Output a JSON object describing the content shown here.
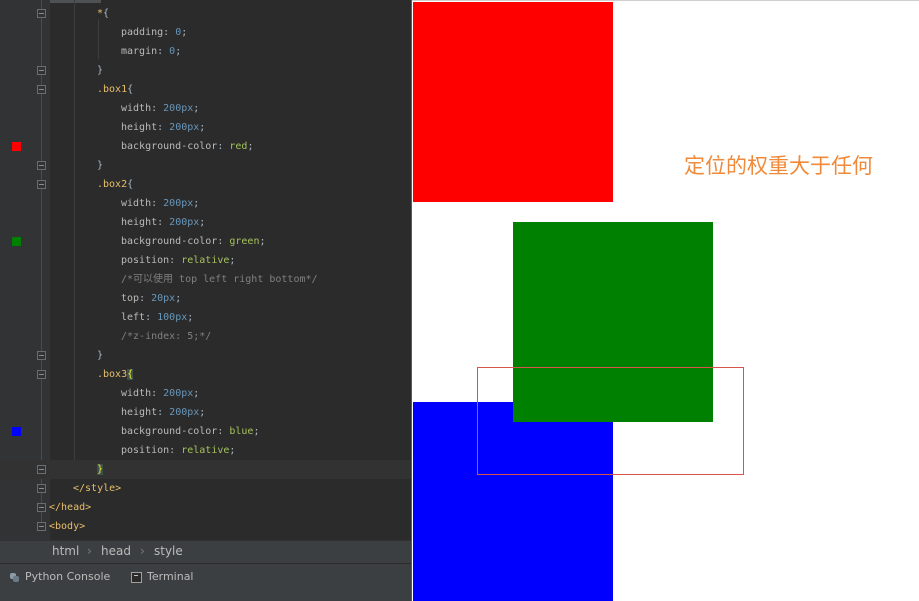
{
  "editor": {
    "lines": [
      {
        "segments": [
          {
            "cls": "tok-sel",
            "text": "*"
          },
          {
            "cls": "tok-brace",
            "text": "{"
          }
        ]
      },
      {
        "segments": [
          {
            "cls": "tok-prop",
            "text": "padding"
          },
          {
            "cls": "tok-brace",
            "text": ": "
          },
          {
            "cls": "tok-num",
            "text": "0"
          },
          {
            "cls": "tok-brace",
            "text": ";"
          }
        ]
      },
      {
        "segments": [
          {
            "cls": "tok-prop",
            "text": "margin"
          },
          {
            "cls": "tok-brace",
            "text": ": "
          },
          {
            "cls": "tok-num",
            "text": "0"
          },
          {
            "cls": "tok-brace",
            "text": ";"
          }
        ]
      },
      {
        "segments": [
          {
            "cls": "tok-brace",
            "text": "}"
          }
        ]
      },
      {
        "segments": [
          {
            "cls": "tok-cls",
            "text": ".box1"
          },
          {
            "cls": "tok-brace",
            "text": "{"
          }
        ]
      },
      {
        "segments": [
          {
            "cls": "tok-prop",
            "text": "width"
          },
          {
            "cls": "tok-brace",
            "text": ": "
          },
          {
            "cls": "tok-num",
            "text": "200px"
          },
          {
            "cls": "tok-brace",
            "text": ";"
          }
        ]
      },
      {
        "segments": [
          {
            "cls": "tok-prop",
            "text": "height"
          },
          {
            "cls": "tok-brace",
            "text": ": "
          },
          {
            "cls": "tok-num",
            "text": "200px"
          },
          {
            "cls": "tok-brace",
            "text": ";"
          }
        ]
      },
      {
        "segments": [
          {
            "cls": "tok-prop",
            "text": "background-color"
          },
          {
            "cls": "tok-brace",
            "text": ": "
          },
          {
            "cls": "tok-kw",
            "text": "red"
          },
          {
            "cls": "tok-brace",
            "text": ";"
          }
        ],
        "swatch": "#ff0000"
      },
      {
        "segments": [
          {
            "cls": "tok-brace",
            "text": "}"
          }
        ]
      },
      {
        "segments": [
          {
            "cls": "tok-cls",
            "text": ".box2"
          },
          {
            "cls": "tok-brace",
            "text": "{"
          }
        ]
      },
      {
        "segments": [
          {
            "cls": "tok-prop",
            "text": "width"
          },
          {
            "cls": "tok-brace",
            "text": ": "
          },
          {
            "cls": "tok-num",
            "text": "200px"
          },
          {
            "cls": "tok-brace",
            "text": ";"
          }
        ]
      },
      {
        "segments": [
          {
            "cls": "tok-prop",
            "text": "height"
          },
          {
            "cls": "tok-brace",
            "text": ": "
          },
          {
            "cls": "tok-num",
            "text": "200px"
          },
          {
            "cls": "tok-brace",
            "text": ";"
          }
        ]
      },
      {
        "segments": [
          {
            "cls": "tok-prop",
            "text": "background-color"
          },
          {
            "cls": "tok-brace",
            "text": ": "
          },
          {
            "cls": "tok-kw",
            "text": "green"
          },
          {
            "cls": "tok-brace",
            "text": ";"
          }
        ],
        "swatch": "#008000"
      },
      {
        "segments": [
          {
            "cls": "tok-prop",
            "text": "position"
          },
          {
            "cls": "tok-brace",
            "text": ": "
          },
          {
            "cls": "tok-kw",
            "text": "relative"
          },
          {
            "cls": "tok-brace",
            "text": ";"
          }
        ]
      },
      {
        "segments": [
          {
            "cls": "tok-cmt",
            "text": "/*可以使用 top left right bottom*/"
          }
        ]
      },
      {
        "segments": [
          {
            "cls": "tok-prop",
            "text": "top"
          },
          {
            "cls": "tok-brace",
            "text": ": "
          },
          {
            "cls": "tok-num",
            "text": "20px"
          },
          {
            "cls": "tok-brace",
            "text": ";"
          }
        ]
      },
      {
        "segments": [
          {
            "cls": "tok-prop",
            "text": "left"
          },
          {
            "cls": "tok-brace",
            "text": ": "
          },
          {
            "cls": "tok-num",
            "text": "100px"
          },
          {
            "cls": "tok-brace",
            "text": ";"
          }
        ]
      },
      {
        "segments": [
          {
            "cls": "tok-cmt",
            "text": "/*z-index: 5;*/"
          }
        ]
      },
      {
        "segments": [
          {
            "cls": "tok-brace",
            "text": "}"
          }
        ]
      },
      {
        "segments": [
          {
            "cls": "tok-cls",
            "text": ".box3"
          },
          {
            "cls": "tok-brace-hl",
            "text": "{"
          }
        ]
      },
      {
        "segments": [
          {
            "cls": "tok-prop",
            "text": "width"
          },
          {
            "cls": "tok-brace",
            "text": ": "
          },
          {
            "cls": "tok-num",
            "text": "200px"
          },
          {
            "cls": "tok-brace",
            "text": ";"
          }
        ]
      },
      {
        "segments": [
          {
            "cls": "tok-prop",
            "text": "height"
          },
          {
            "cls": "tok-brace",
            "text": ": "
          },
          {
            "cls": "tok-num",
            "text": "200px"
          },
          {
            "cls": "tok-brace",
            "text": ";"
          }
        ]
      },
      {
        "segments": [
          {
            "cls": "tok-prop",
            "text": "background-color"
          },
          {
            "cls": "tok-brace",
            "text": ": "
          },
          {
            "cls": "tok-kw",
            "text": "blue"
          },
          {
            "cls": "tok-brace",
            "text": ";"
          }
        ],
        "swatch": "#0000ff"
      },
      {
        "segments": [
          {
            "cls": "tok-prop",
            "text": "position"
          },
          {
            "cls": "tok-brace",
            "text": ": "
          },
          {
            "cls": "tok-kw",
            "text": "relative"
          },
          {
            "cls": "tok-brace",
            "text": ";"
          }
        ]
      },
      {
        "segments": [
          {
            "cls": "tok-brace-hl2",
            "text": "}"
          }
        ]
      },
      {
        "segments": [
          {
            "cls": "tok-tag",
            "text": "</style>"
          }
        ]
      },
      {
        "segments": [
          {
            "cls": "tok-tag",
            "text": "</head>"
          }
        ]
      },
      {
        "segments": [
          {
            "cls": "tok-tag",
            "text": "<body>"
          }
        ]
      }
    ]
  },
  "breadcrumb": {
    "items": [
      "html",
      "head",
      "style"
    ]
  },
  "tool_windows": {
    "python_console": "Python Console",
    "terminal": "Terminal"
  },
  "preview": {
    "caption": "定位的权重大于任何",
    "box_colors": {
      "box1": "#ff0000",
      "box2": "#008000",
      "box3": "#0000ff"
    },
    "annotation_color": "#d9534f"
  }
}
